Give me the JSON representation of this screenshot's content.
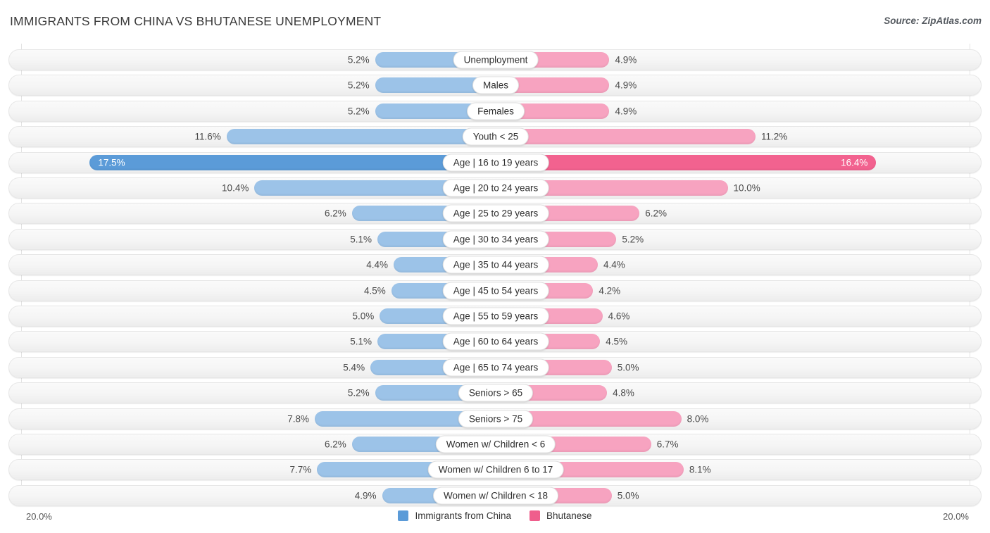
{
  "header": {
    "title": "IMMIGRANTS FROM CHINA VS BHUTANESE UNEMPLOYMENT",
    "source": "Source: ZipAtlas.com"
  },
  "axis": {
    "left_max_label": "20.0%",
    "right_max_label": "20.0%",
    "max_value": 20.0
  },
  "legend": {
    "items": [
      {
        "label": "Immigrants from China",
        "color": "#5b9bd8",
        "swatch_name": "legend-swatch-immigrants-from-china"
      },
      {
        "label": "Bhutanese",
        "color": "#ef5e8c",
        "swatch_name": "legend-swatch-bhutanese"
      }
    ]
  },
  "colors": {
    "left_bar": "#9cc3e8",
    "right_bar": "#f7a3c0",
    "left_bar_highlight": "#5b9bd8",
    "right_bar_highlight": "#f2628f",
    "row_track": "#f5f5f5",
    "gridline": "#e3e3e3"
  },
  "chart_data": {
    "type": "bar",
    "title": "IMMIGRANTS FROM CHINA VS BHUTANESE UNEMPLOYMENT",
    "subtitle": "Source: ZipAtlas.com",
    "orientation": "horizontal-diverging",
    "xlabel": "",
    "ylabel": "",
    "xlim": [
      20.0,
      20.0
    ],
    "grid": true,
    "legend_position": "bottom-center",
    "categories": [
      "Unemployment",
      "Males",
      "Females",
      "Youth < 25",
      "Age | 16 to 19 years",
      "Age | 20 to 24 years",
      "Age | 25 to 29 years",
      "Age | 30 to 34 years",
      "Age | 35 to 44 years",
      "Age | 45 to 54 years",
      "Age | 55 to 59 years",
      "Age | 60 to 64 years",
      "Age | 65 to 74 years",
      "Seniors > 65",
      "Seniors > 75",
      "Women w/ Children < 6",
      "Women w/ Children 6 to 17",
      "Women w/ Children < 18"
    ],
    "series": [
      {
        "name": "Immigrants from China",
        "side": "left",
        "color": "#9cc3e8",
        "values": [
          5.2,
          5.2,
          5.2,
          11.6,
          17.5,
          10.4,
          6.2,
          5.1,
          4.4,
          4.5,
          5.0,
          5.1,
          5.4,
          5.2,
          7.8,
          6.2,
          7.7,
          4.9
        ],
        "labels": [
          "5.2%",
          "5.2%",
          "5.2%",
          "11.6%",
          "17.5%",
          "10.4%",
          "6.2%",
          "5.1%",
          "4.4%",
          "4.5%",
          "5.0%",
          "5.1%",
          "5.4%",
          "5.2%",
          "7.8%",
          "6.2%",
          "7.7%",
          "4.9%"
        ]
      },
      {
        "name": "Bhutanese",
        "side": "right",
        "color": "#f7a3c0",
        "values": [
          4.9,
          4.9,
          4.9,
          11.2,
          16.4,
          10.0,
          6.2,
          5.2,
          4.4,
          4.2,
          4.6,
          4.5,
          5.0,
          4.8,
          8.0,
          6.7,
          8.1,
          5.0
        ],
        "labels": [
          "4.9%",
          "4.9%",
          "4.9%",
          "11.2%",
          "16.4%",
          "10.0%",
          "6.2%",
          "5.2%",
          "4.4%",
          "4.2%",
          "4.6%",
          "4.5%",
          "5.0%",
          "4.8%",
          "8.0%",
          "6.7%",
          "8.1%",
          "5.0%"
        ]
      }
    ],
    "highlighted_category": "Age | 16 to 19 years"
  },
  "rows": [
    {
      "label": "Unemployment",
      "left_value": 5.2,
      "left_label": "5.2%",
      "right_value": 4.9,
      "right_label": "4.9%",
      "highlight": false
    },
    {
      "label": "Males",
      "left_value": 5.2,
      "left_label": "5.2%",
      "right_value": 4.9,
      "right_label": "4.9%",
      "highlight": false
    },
    {
      "label": "Females",
      "left_value": 5.2,
      "left_label": "5.2%",
      "right_value": 4.9,
      "right_label": "4.9%",
      "highlight": false
    },
    {
      "label": "Youth < 25",
      "left_value": 11.6,
      "left_label": "11.6%",
      "right_value": 11.2,
      "right_label": "11.2%",
      "highlight": false
    },
    {
      "label": "Age | 16 to 19 years",
      "left_value": 17.5,
      "left_label": "17.5%",
      "right_value": 16.4,
      "right_label": "16.4%",
      "highlight": true
    },
    {
      "label": "Age | 20 to 24 years",
      "left_value": 10.4,
      "left_label": "10.4%",
      "right_value": 10.0,
      "right_label": "10.0%",
      "highlight": false
    },
    {
      "label": "Age | 25 to 29 years",
      "left_value": 6.2,
      "left_label": "6.2%",
      "right_value": 6.2,
      "right_label": "6.2%",
      "highlight": false
    },
    {
      "label": "Age | 30 to 34 years",
      "left_value": 5.1,
      "left_label": "5.1%",
      "right_value": 5.2,
      "right_label": "5.2%",
      "highlight": false
    },
    {
      "label": "Age | 35 to 44 years",
      "left_value": 4.4,
      "left_label": "4.4%",
      "right_value": 4.4,
      "right_label": "4.4%",
      "highlight": false
    },
    {
      "label": "Age | 45 to 54 years",
      "left_value": 4.5,
      "left_label": "4.5%",
      "right_value": 4.2,
      "right_label": "4.2%",
      "highlight": false
    },
    {
      "label": "Age | 55 to 59 years",
      "left_value": 5.0,
      "left_label": "5.0%",
      "right_value": 4.6,
      "right_label": "4.6%",
      "highlight": false
    },
    {
      "label": "Age | 60 to 64 years",
      "left_value": 5.1,
      "left_label": "5.1%",
      "right_value": 4.5,
      "right_label": "4.5%",
      "highlight": false
    },
    {
      "label": "Age | 65 to 74 years",
      "left_value": 5.4,
      "left_label": "5.4%",
      "right_value": 5.0,
      "right_label": "5.0%",
      "highlight": false
    },
    {
      "label": "Seniors > 65",
      "left_value": 5.2,
      "left_label": "5.2%",
      "right_value": 4.8,
      "right_label": "4.8%",
      "highlight": false
    },
    {
      "label": "Seniors > 75",
      "left_value": 7.8,
      "left_label": "7.8%",
      "right_value": 8.0,
      "right_label": "8.0%",
      "highlight": false
    },
    {
      "label": "Women w/ Children < 6",
      "left_value": 6.2,
      "left_label": "6.2%",
      "right_value": 6.7,
      "right_label": "6.7%",
      "highlight": false
    },
    {
      "label": "Women w/ Children 6 to 17",
      "left_value": 7.7,
      "left_label": "7.7%",
      "right_value": 8.1,
      "right_label": "8.1%",
      "highlight": false
    },
    {
      "label": "Women w/ Children < 18",
      "left_value": 4.9,
      "left_label": "4.9%",
      "right_value": 5.0,
      "right_label": "5.0%",
      "highlight": false
    }
  ]
}
